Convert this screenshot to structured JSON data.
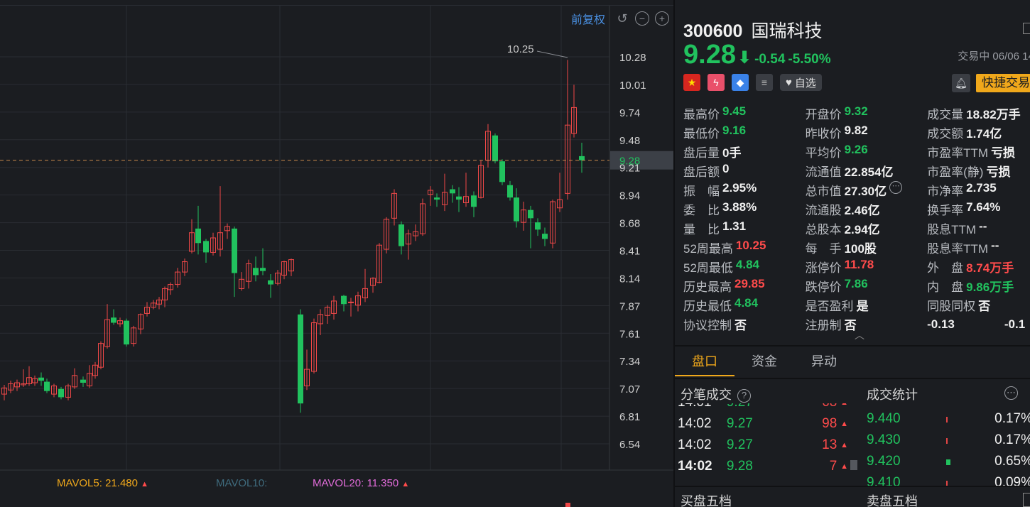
{
  "toolbar": {
    "adjust_label": "前复权",
    "undo_glyph": "↺",
    "zoom_out_glyph": "−",
    "zoom_in_glyph": "+"
  },
  "chart": {
    "price_axis": [
      "10.28",
      "10.01",
      "9.74",
      "9.48",
      "9.21",
      "8.94",
      "8.68",
      "8.41",
      "8.14",
      "7.87",
      "7.61",
      "7.34",
      "7.07",
      "6.81",
      "6.54"
    ],
    "high_marker": "10.25",
    "current_price_label": "9.28",
    "colors": {
      "up": "#f04848",
      "down": "#21c25e",
      "dash": "#c98a4a",
      "grid": "#2a2d33",
      "axis_text": "#d0d0d0",
      "price_tag_bg": "#3c4047"
    }
  },
  "mavol": [
    {
      "label": "MAVOL5:",
      "value": "21.480",
      "arrow": "▲",
      "color": "#f0a81b"
    },
    {
      "label": "MAVOL10:",
      "value": "",
      "arrow": "",
      "color": "#3f6b7d"
    },
    {
      "label": "MAVOL20:",
      "value": "11.350",
      "arrow": "▲",
      "color": "#e06bd8"
    }
  ],
  "stock": {
    "code": "300600",
    "name": "国瑞科技",
    "price": "9.28",
    "arrow": "⬇",
    "change": "-0.54",
    "change_pct": "-5.50%",
    "status": "交易中 06/06 14:",
    "watch_label": "自选",
    "quick_trade_label": "快捷交易"
  },
  "stats": [
    [
      {
        "l": "最高价",
        "v": "9.45",
        "c": "green"
      },
      {
        "l": "开盘价",
        "v": "9.32",
        "c": "green"
      },
      {
        "l": "成交量",
        "v": "18.82万手",
        "c": ""
      }
    ],
    [
      {
        "l": "最低价",
        "v": "9.16",
        "c": "green"
      },
      {
        "l": "昨收价",
        "v": "9.82",
        "c": ""
      },
      {
        "l": "成交额",
        "v": "1.74亿",
        "c": ""
      }
    ],
    [
      {
        "l": "盘后量",
        "v": "0手",
        "c": ""
      },
      {
        "l": "平均价",
        "v": "9.26",
        "c": "green"
      },
      {
        "l": "市盈率TTM",
        "v": "亏损",
        "c": ""
      }
    ],
    [
      {
        "l": "盘后额",
        "v": "0",
        "c": ""
      },
      {
        "l": "流通值",
        "v": "22.854亿",
        "c": ""
      },
      {
        "l": "市盈率(静)",
        "v": "亏损",
        "c": ""
      }
    ],
    [
      {
        "l": "振　幅",
        "v": "2.95%",
        "c": ""
      },
      {
        "l": "总市值",
        "v": "27.30亿",
        "c": "",
        "more": true
      },
      {
        "l": "市净率",
        "v": "2.735",
        "c": ""
      }
    ],
    [
      {
        "l": "委　比",
        "v": "3.88%",
        "c": ""
      },
      {
        "l": "流通股",
        "v": "2.46亿",
        "c": ""
      },
      {
        "l": "换手率",
        "v": "7.64%",
        "c": ""
      }
    ],
    [
      {
        "l": "量　比",
        "v": "1.31",
        "c": ""
      },
      {
        "l": "总股本",
        "v": "2.94亿",
        "c": ""
      },
      {
        "l": "股息TTM",
        "v": "--",
        "c": ""
      }
    ],
    [
      {
        "l": "52周最高",
        "v": "10.25",
        "c": "red"
      },
      {
        "l": "每　手",
        "v": "100股",
        "c": ""
      },
      {
        "l": "股息率TTM",
        "v": "--",
        "c": ""
      }
    ],
    [
      {
        "l": "52周最低",
        "v": "4.84",
        "c": "green"
      },
      {
        "l": "涨停价",
        "v": "11.78",
        "c": "red"
      },
      {
        "l": "外　盘",
        "v": "8.74万手",
        "c": "red"
      }
    ],
    [
      {
        "l": "历史最高",
        "v": "29.85",
        "c": "red"
      },
      {
        "l": "跌停价",
        "v": "7.86",
        "c": "green"
      },
      {
        "l": "内　盘",
        "v": "9.86万手",
        "c": "green"
      }
    ],
    [
      {
        "l": "历史最低",
        "v": "4.84",
        "c": "green"
      },
      {
        "l": "是否盈利",
        "v": "是",
        "c": ""
      },
      {
        "l": "同股同权",
        "v": "否",
        "c": ""
      }
    ],
    [
      {
        "l": "协议控制",
        "v": "否",
        "c": ""
      },
      {
        "l": "注册制",
        "v": "否",
        "c": ""
      },
      {
        "l": "",
        "v": "-0.13",
        "c": "",
        "extra": "-0.1"
      }
    ]
  ],
  "tabs": [
    "盘口",
    "资金",
    "异动"
  ],
  "ticks_title": "分笔成交",
  "ticks": [
    {
      "t": "14:01",
      "p": "9.27",
      "v": "68",
      "ar": "▲"
    },
    {
      "t": "14:02",
      "p": "9.27",
      "v": "98",
      "ar": "▲"
    },
    {
      "t": "14:02",
      "p": "9.27",
      "v": "13",
      "ar": "▲"
    },
    {
      "t": "14:02",
      "p": "9.28",
      "v": "7",
      "ar": "▲"
    }
  ],
  "vstats_title": "成交统计",
  "vstats": [
    {
      "p": "9.440",
      "pct": "0.17%",
      "share": 0.0017
    },
    {
      "p": "9.430",
      "pct": "0.17%",
      "share": 0.0017
    },
    {
      "p": "9.420",
      "pct": "0.65%",
      "share": 0.0065
    },
    {
      "p": "9.410",
      "pct": "0.09%",
      "share": 0.0009
    }
  ],
  "bid_title": "买盘五档",
  "ask_title": "卖盘五档"
}
